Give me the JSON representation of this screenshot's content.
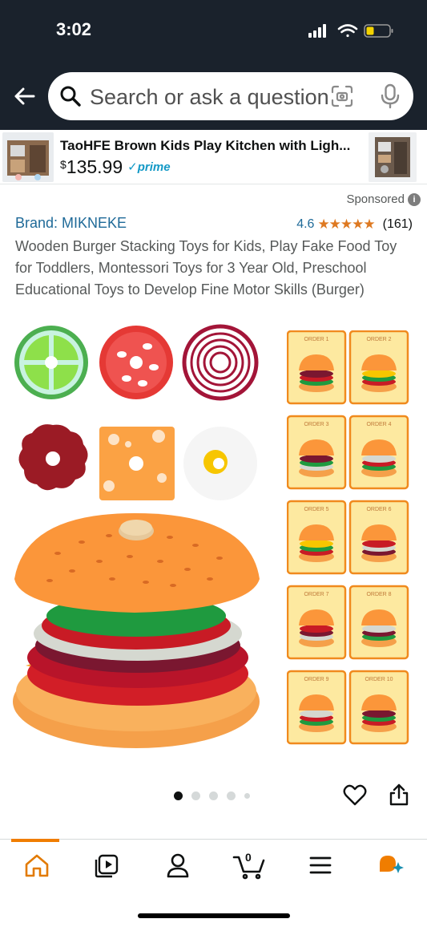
{
  "status_bar": {
    "time": "3:02"
  },
  "search": {
    "placeholder": "Search or ask a question"
  },
  "ad": {
    "title": "TaoHFE Brown Kids Play Kitchen with Ligh...",
    "currency": "$",
    "price": "135.99",
    "prime_label": "✓prime"
  },
  "sponsored_label": "Sponsored",
  "product": {
    "brand": "Brand: MIKNEKE",
    "rating": "4.6",
    "stars": "★★★★★",
    "review_count": "(161)",
    "title": "Wooden Burger Stacking Toys for Kids, Play Fake Food Toy for Toddlers, Montessori Toys for 3 Year Old, Preschool Educational Toys to Develop Fine Motor Skills (Burger)"
  },
  "order_cards": [
    "ORDER 1",
    "ORDER 2",
    "ORDER 3",
    "ORDER 4",
    "ORDER 5",
    "ORDER 6",
    "ORDER 7",
    "ORDER 8",
    "ORDER 9",
    "ORDER 10"
  ],
  "carousel": {
    "total": 5,
    "active": 1
  },
  "bottom_nav": {
    "items": [
      "home",
      "video",
      "account",
      "cart",
      "menu",
      "rufus"
    ],
    "cart_count": "0"
  },
  "colors": {
    "header_bg": "#1a222c",
    "link": "#1f6a98",
    "star": "#de7921",
    "accent": "#f07d00",
    "prime": "#1399c6"
  }
}
